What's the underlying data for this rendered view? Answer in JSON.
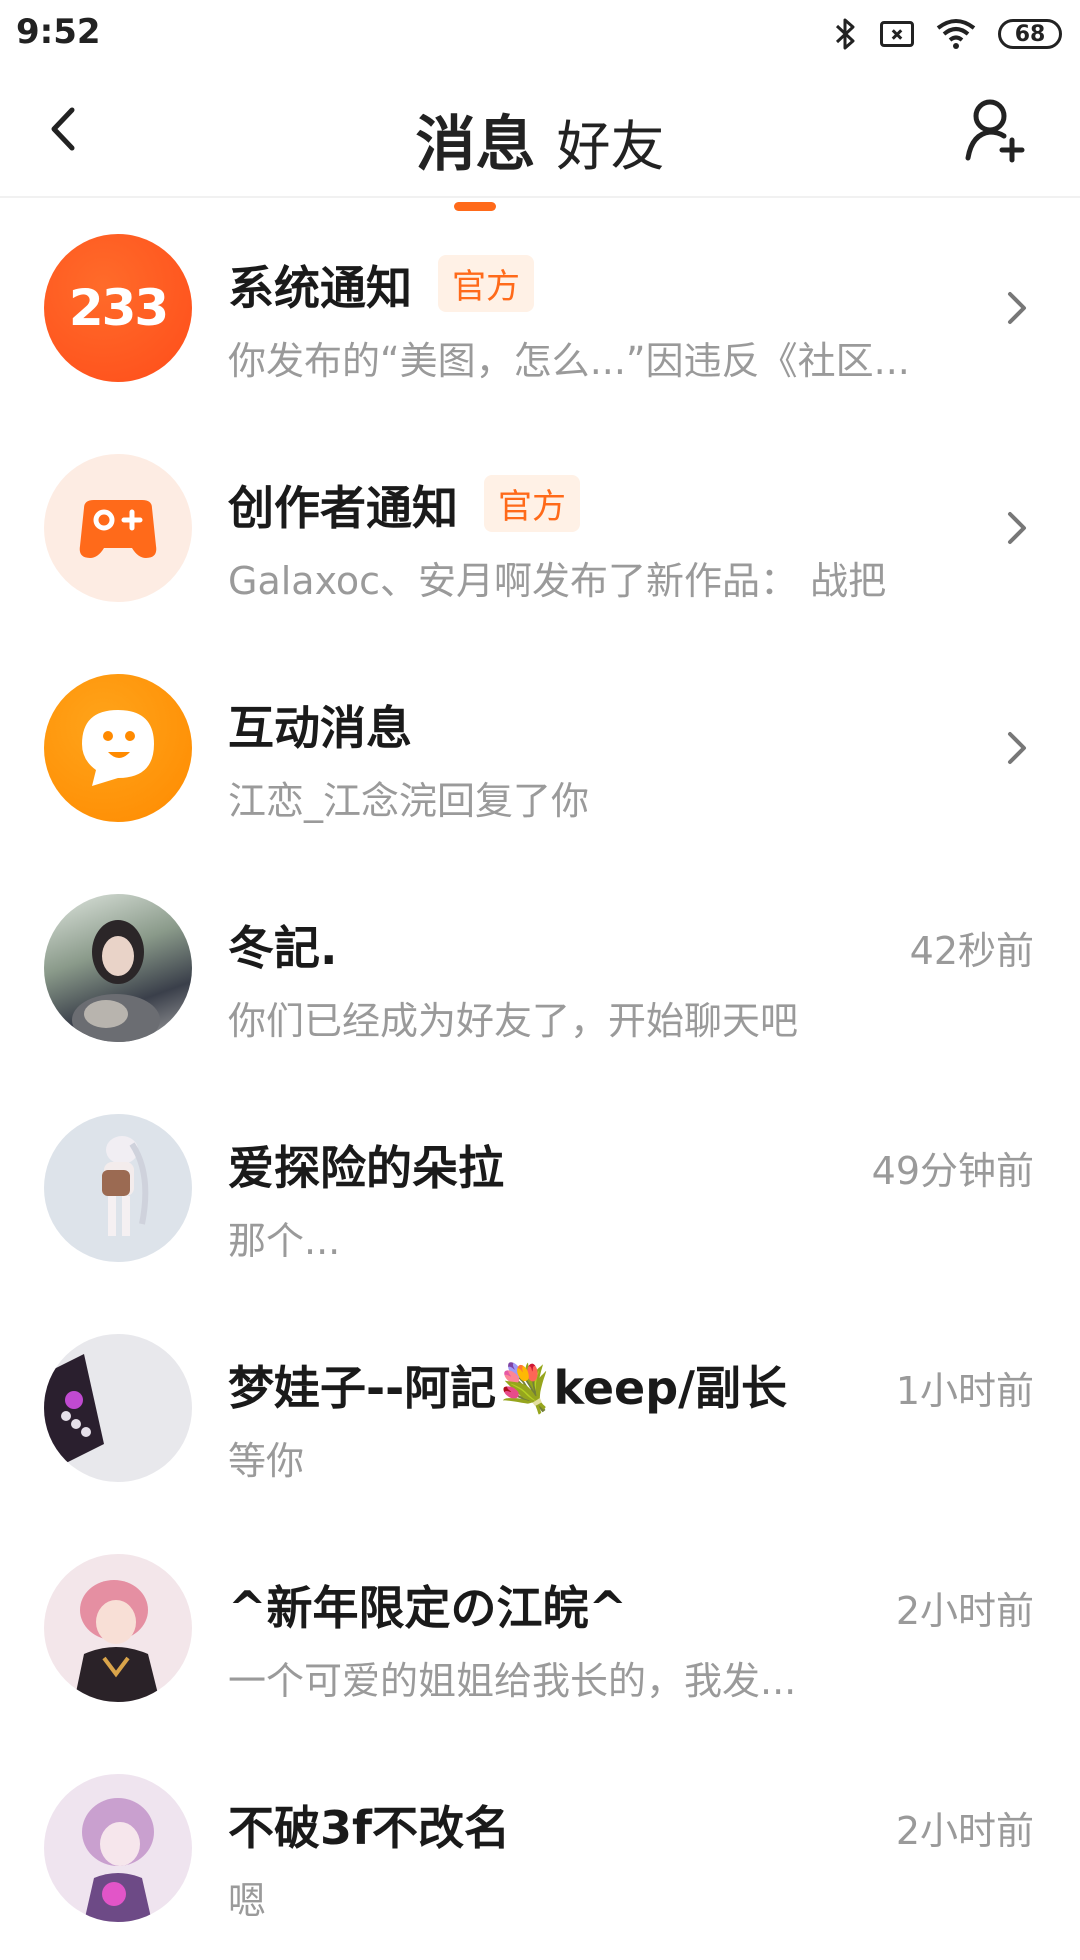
{
  "status": {
    "time": "9:52",
    "battery": "68"
  },
  "header": {
    "tab_messages": "消息",
    "tab_friends": "好友"
  },
  "colors": {
    "accent": "#ff6a1a",
    "badge_bg": "#fff1e6",
    "muted_text": "#9a9a9a"
  },
  "items": [
    {
      "title": "系统通知",
      "badge": "官方",
      "subtitle": "你发布的“美图，怎么...”因违反《社区...",
      "avatar_text": "233",
      "icon": "system-233-icon"
    },
    {
      "title": "创作者通知",
      "badge": "官方",
      "subtitle": "Galaxoc、安月啊发布了新作品： 战把",
      "icon": "gamepad-icon"
    },
    {
      "title": "互动消息",
      "subtitle": "江恋_江念浣回复了你",
      "icon": "chat-bubble-icon"
    },
    {
      "title": "冬記.",
      "time": "42秒前",
      "subtitle": "你们已经成为好友了，开始聊天吧"
    },
    {
      "title": "爱探险的朵拉",
      "time": "49分钟前",
      "subtitle": "那个..."
    },
    {
      "title": "梦娃子--阿記💐keep/副长",
      "time": "1小时前",
      "subtitle": "等你"
    },
    {
      "title": "^新年限定の江皖^",
      "time": "2小时前",
      "subtitle": "一个可爱的姐姐给我长的，我发..."
    },
    {
      "title": "不破3f不改名",
      "time": "2小时前",
      "subtitle": "嗯"
    }
  ]
}
